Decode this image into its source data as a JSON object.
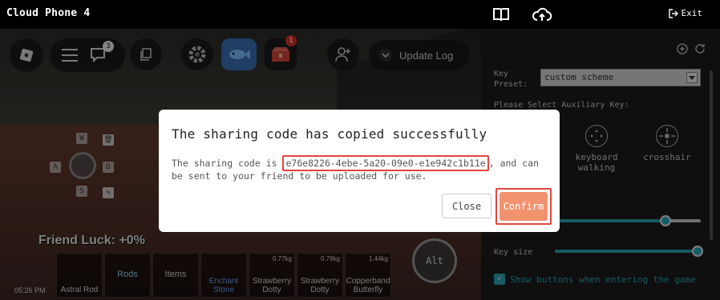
{
  "titlebar": {
    "title": "Cloud Phone 4",
    "exit_label": "Exit"
  },
  "game": {
    "chat_badge": "3",
    "alert_badge": "1",
    "update_log": "Update Log",
    "dpad": {
      "up": "W",
      "left": "A",
      "right": "D",
      "down": "S"
    },
    "luck_text": "Friend Luck: +0%",
    "time": "05:26 PM",
    "alt_label": "Alt",
    "hotbar": [
      {
        "label": "Astral Rod",
        "weight": ""
      },
      {
        "label": "Rods",
        "weight": ""
      },
      {
        "label": "Items",
        "weight": ""
      },
      {
        "label": "Enchant Stone",
        "weight": ""
      },
      {
        "label": "Strawberry Dotty",
        "weight": "0.77kg"
      },
      {
        "label": "Strawberry Dotty",
        "weight": "0.79kg"
      },
      {
        "label": "Copperband Butterfly",
        "weight": "1.44kg"
      }
    ]
  },
  "panel": {
    "key_preset_label": "Key Preset:",
    "key_preset_value": "custom scheme",
    "aux_label": "Please Select Auxiliary Key:",
    "aux_keys": [
      {
        "label": "keyboard walking"
      },
      {
        "label": "crosshair"
      }
    ],
    "slider1_level": 0.76,
    "key_size_label": "Key size",
    "key_size_level": 0.98,
    "show_buttons_label": "Show buttons when entering the game"
  },
  "dialog": {
    "title": "The sharing code has copied successfully",
    "msg_prefix": "The sharing code is ",
    "code": "e76e8226-4ebe-5a20-09e0-e1e942c1b11e",
    "msg_suffix": ", and can be sent to your friend to be uploaded for use.",
    "close_label": "Close",
    "confirm_label": "Confirm"
  },
  "colors": {
    "accent": "#2aa7b7",
    "confirm": "#f2936f",
    "highlight": "#e0463d"
  }
}
